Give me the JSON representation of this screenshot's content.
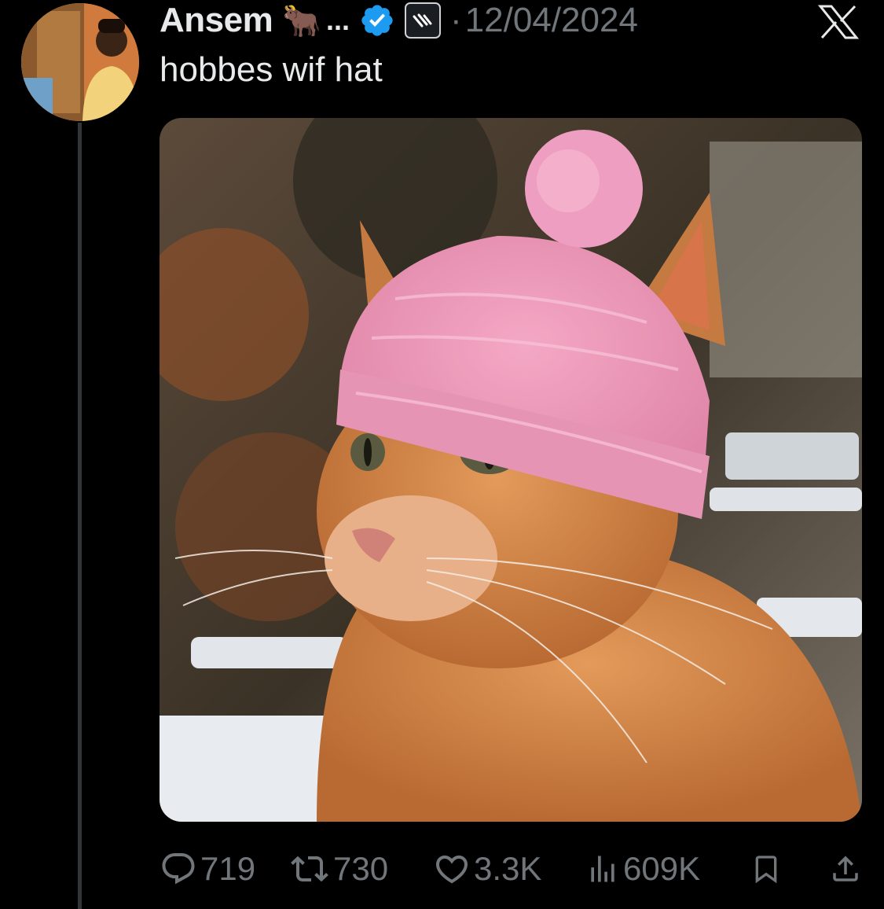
{
  "tweet": {
    "author_name": "Ansem",
    "author_emoji": "🐂",
    "name_ellipsis": "...",
    "separator": "·",
    "date": "12/04/2024",
    "text": "hobbes wif hat"
  },
  "actions": {
    "replies": "719",
    "reposts": "730",
    "likes": "3.3K",
    "views": "609K"
  },
  "icons": {
    "verified": "verified-badge-icon",
    "affiliate": "affiliate-badge-icon",
    "platform": "x-logo-icon",
    "reply": "reply-icon",
    "repost": "repost-icon",
    "like": "heart-icon",
    "views": "views-chart-icon",
    "bookmark": "bookmark-icon",
    "share": "share-icon"
  },
  "colors": {
    "background": "#000000",
    "text_primary": "#e7e9ea",
    "text_secondary": "#71767b",
    "verified_blue": "#1d9bf0"
  }
}
